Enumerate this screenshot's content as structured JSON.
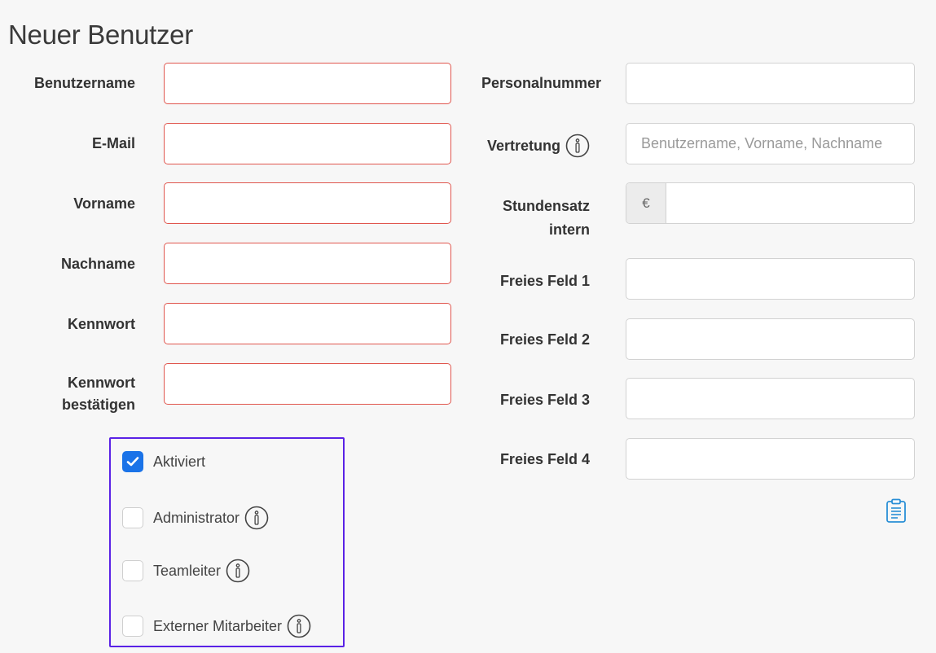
{
  "page": {
    "title": "Neuer Benutzer"
  },
  "left_fields": {
    "username": {
      "label": "Benutzername",
      "value": ""
    },
    "email": {
      "label": "E-Mail",
      "value": ""
    },
    "firstname": {
      "label": "Vorname",
      "value": ""
    },
    "lastname": {
      "label": "Nachname",
      "value": ""
    },
    "password": {
      "label": "Kennwort",
      "value": ""
    },
    "password_confirm": {
      "label_line1": "Kennwort",
      "label_line2": "bestätigen",
      "value": ""
    }
  },
  "right_fields": {
    "personnel_number": {
      "label": "Personalnummer",
      "value": ""
    },
    "substitute": {
      "label": "Vertretung",
      "value": "",
      "placeholder": "Benutzername, Vorname, Nachname"
    },
    "hourly_rate": {
      "label_line1": "Stundensatz",
      "label_line2": "intern",
      "currency": "€",
      "value": ""
    },
    "custom1": {
      "label": "Freies Feld 1",
      "value": ""
    },
    "custom2": {
      "label": "Freies Feld 2",
      "value": ""
    },
    "custom3": {
      "label": "Freies Feld 3",
      "value": ""
    },
    "custom4": {
      "label": "Freies Feld 4",
      "value": ""
    }
  },
  "checkboxes": {
    "activated": {
      "label": "Aktiviert",
      "checked": true
    },
    "administrator": {
      "label": "Administrator",
      "checked": false
    },
    "teamlead": {
      "label": "Teamleiter",
      "checked": false
    },
    "external": {
      "label": "Externer Mitarbeiter",
      "checked": false
    }
  },
  "colors": {
    "invalid_border": "#e0564e",
    "checkbox_checked": "#1a73e8",
    "highlight_frame": "#5a22e6",
    "clipboard_icon": "#2a8fd6"
  },
  "icons": {
    "info": "info-circle-icon",
    "clipboard": "clipboard-icon"
  }
}
